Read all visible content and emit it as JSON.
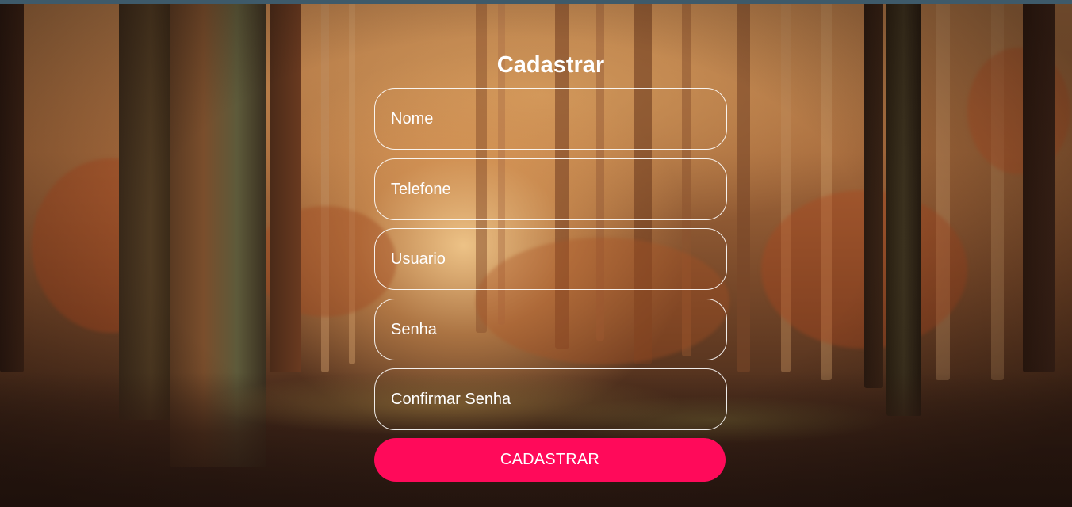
{
  "form": {
    "title": "Cadastrar",
    "fields": [
      {
        "placeholder": "Nome",
        "value": ""
      },
      {
        "placeholder": "Telefone",
        "value": ""
      },
      {
        "placeholder": "Usuario",
        "value": ""
      },
      {
        "placeholder": "Senha",
        "value": ""
      },
      {
        "placeholder": "Confirmar Senha",
        "value": ""
      }
    ],
    "submit_label": "CADASTRAR"
  },
  "colors": {
    "accent": "#ff0a5a",
    "text": "#ffffff",
    "topbar": "#3e5a6a"
  }
}
